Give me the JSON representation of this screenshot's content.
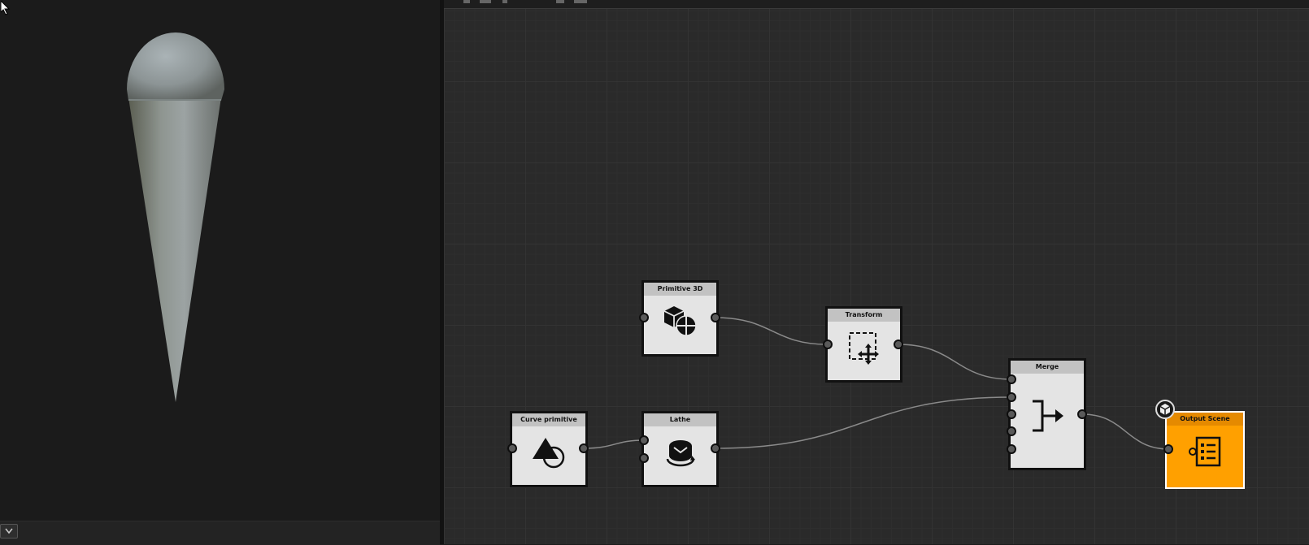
{
  "nodes": {
    "primitive3d": {
      "title": "Primitive 3D"
    },
    "transform": {
      "title": "Transform"
    },
    "merge": {
      "title": "Merge"
    },
    "curve_primitive": {
      "title": "Curve primitive"
    },
    "lathe": {
      "title": "Lathe"
    },
    "output_scene": {
      "title": "Output Scene"
    }
  },
  "colors": {
    "output_node": "#ffa000",
    "output_header": "#e58a00",
    "node_body": "#e4e4e4",
    "node_header": "#c2c2c2",
    "wire": "#8a8a8a"
  },
  "icons": {
    "primitive3d": "cube-sphere-icon",
    "transform": "move-selection-icon",
    "merge": "merge-arrow-icon",
    "curve_primitive": "triangle-circle-icon",
    "lathe": "lathe-revolve-icon",
    "output_scene": "list-output-icon",
    "output_badge": "cube-badge-icon",
    "view_dropdown": "chevron-down-icon"
  }
}
